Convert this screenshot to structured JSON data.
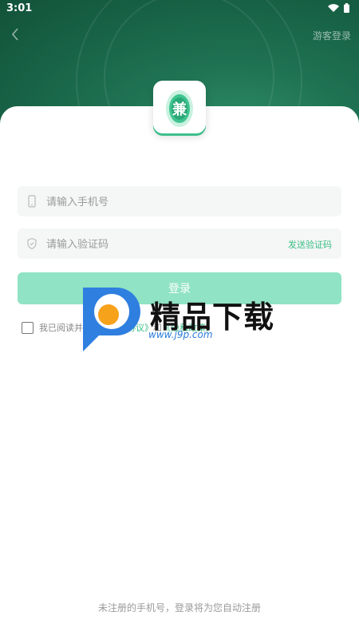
{
  "status_bar": {
    "time": "3:01"
  },
  "header": {
    "guest_login": "游客登录"
  },
  "logo": {
    "glyph": "兼"
  },
  "form": {
    "phone_placeholder": "请输入手机号",
    "code_placeholder": "请输入验证码",
    "send_code": "发送验证码",
    "login_button": "登录"
  },
  "agreement": {
    "prefix": "我已阅读并同意",
    "user_agreement": "《用户协议》",
    "and": "和",
    "privacy_policy": "《隐私政策》"
  },
  "footer": {
    "note": "未注册的手机号，登录将为您自动注册"
  },
  "watermark": {
    "text": "精品下载",
    "url": "www.j9p.com"
  },
  "colors": {
    "brand_green": "#1f7353",
    "accent": "#3cbf86",
    "button_disabled": "#90e3c4"
  }
}
